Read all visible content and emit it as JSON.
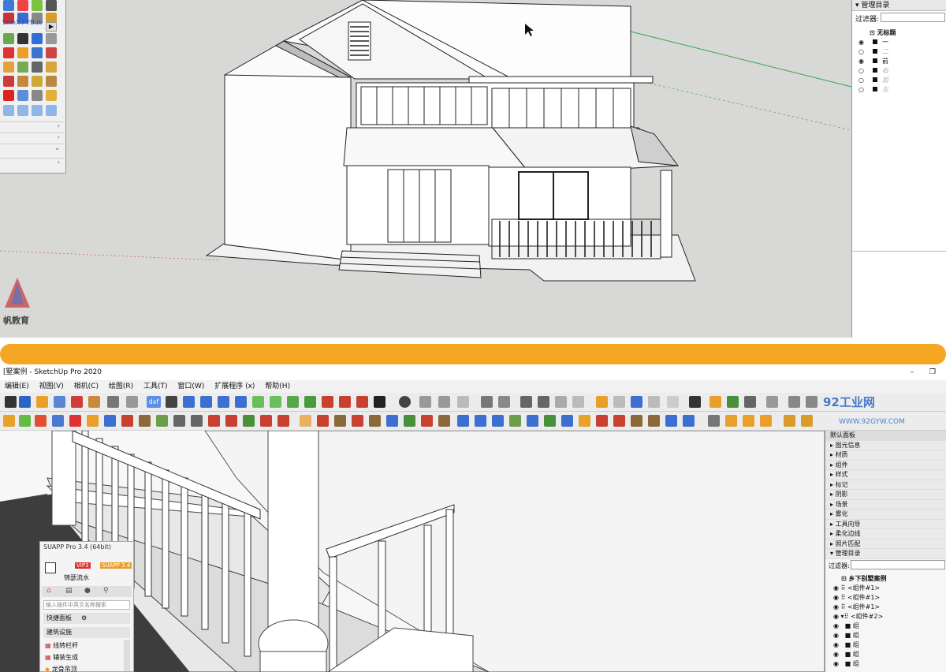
{
  "top": {
    "panel": {
      "plugin_label": "SkinX / YBub",
      "arrow_right": "▶"
    },
    "tray": {
      "header": "管理目录",
      "filter_label": "过滤器:",
      "root": "无标题",
      "layers": [
        {
          "name": "一",
          "visible": true,
          "dim": false
        },
        {
          "name": "二",
          "visible": false,
          "dim": true
        },
        {
          "name": "前",
          "visible": true,
          "dim": false
        },
        {
          "name": "右",
          "visible": false,
          "dim": true
        },
        {
          "name": "后",
          "visible": false,
          "dim": true
        },
        {
          "name": "左",
          "visible": false,
          "dim": true
        }
      ]
    },
    "watermark": "帆教育"
  },
  "bottom": {
    "title": "[墅案例 - SketchUp Pro 2020",
    "menu": [
      "编辑(E)",
      "视图(V)",
      "相机(C)",
      "绘图(R)",
      "工具(T)",
      "窗口(W)",
      "扩展程序 (x)",
      "帮助(H)"
    ],
    "dxf_label": "dxf",
    "brand": "92工业网",
    "brand_url": "WWW.92GYW.COM",
    "tray": {
      "title": "默认面板",
      "items": [
        "图元信息",
        "材质",
        "组件",
        "样式",
        "标记",
        "阴影",
        "场景",
        "雾化",
        "工具向导",
        "柔化边线",
        "照片匹配",
        "管理目录"
      ],
      "filter_label": "过滤器:",
      "root": "乡下别墅案例",
      "tree": [
        "<组件#1>",
        "<组件#1>",
        "<组件#1>",
        "<组件#2>",
        "组",
        "组",
        "组",
        "组",
        "组"
      ]
    },
    "suapp": {
      "title": "SUAPP Pro 3.4 (64bit)",
      "vip": "VIP3",
      "badge": "SUAPP 3.4",
      "user": "锦瑟流水",
      "search_placeholder": "输入插件中英文名称搜索",
      "quick_panel": "快捷面板",
      "section": "建筑设施",
      "tools": [
        "线转栏杆",
        "辅装生成",
        "龙骨吊顶"
      ]
    }
  },
  "colors": {
    "divider": "#f5a623",
    "sky": "#d8d8d6",
    "ground": "#cfcfcf",
    "accent": "#2b64c5"
  }
}
